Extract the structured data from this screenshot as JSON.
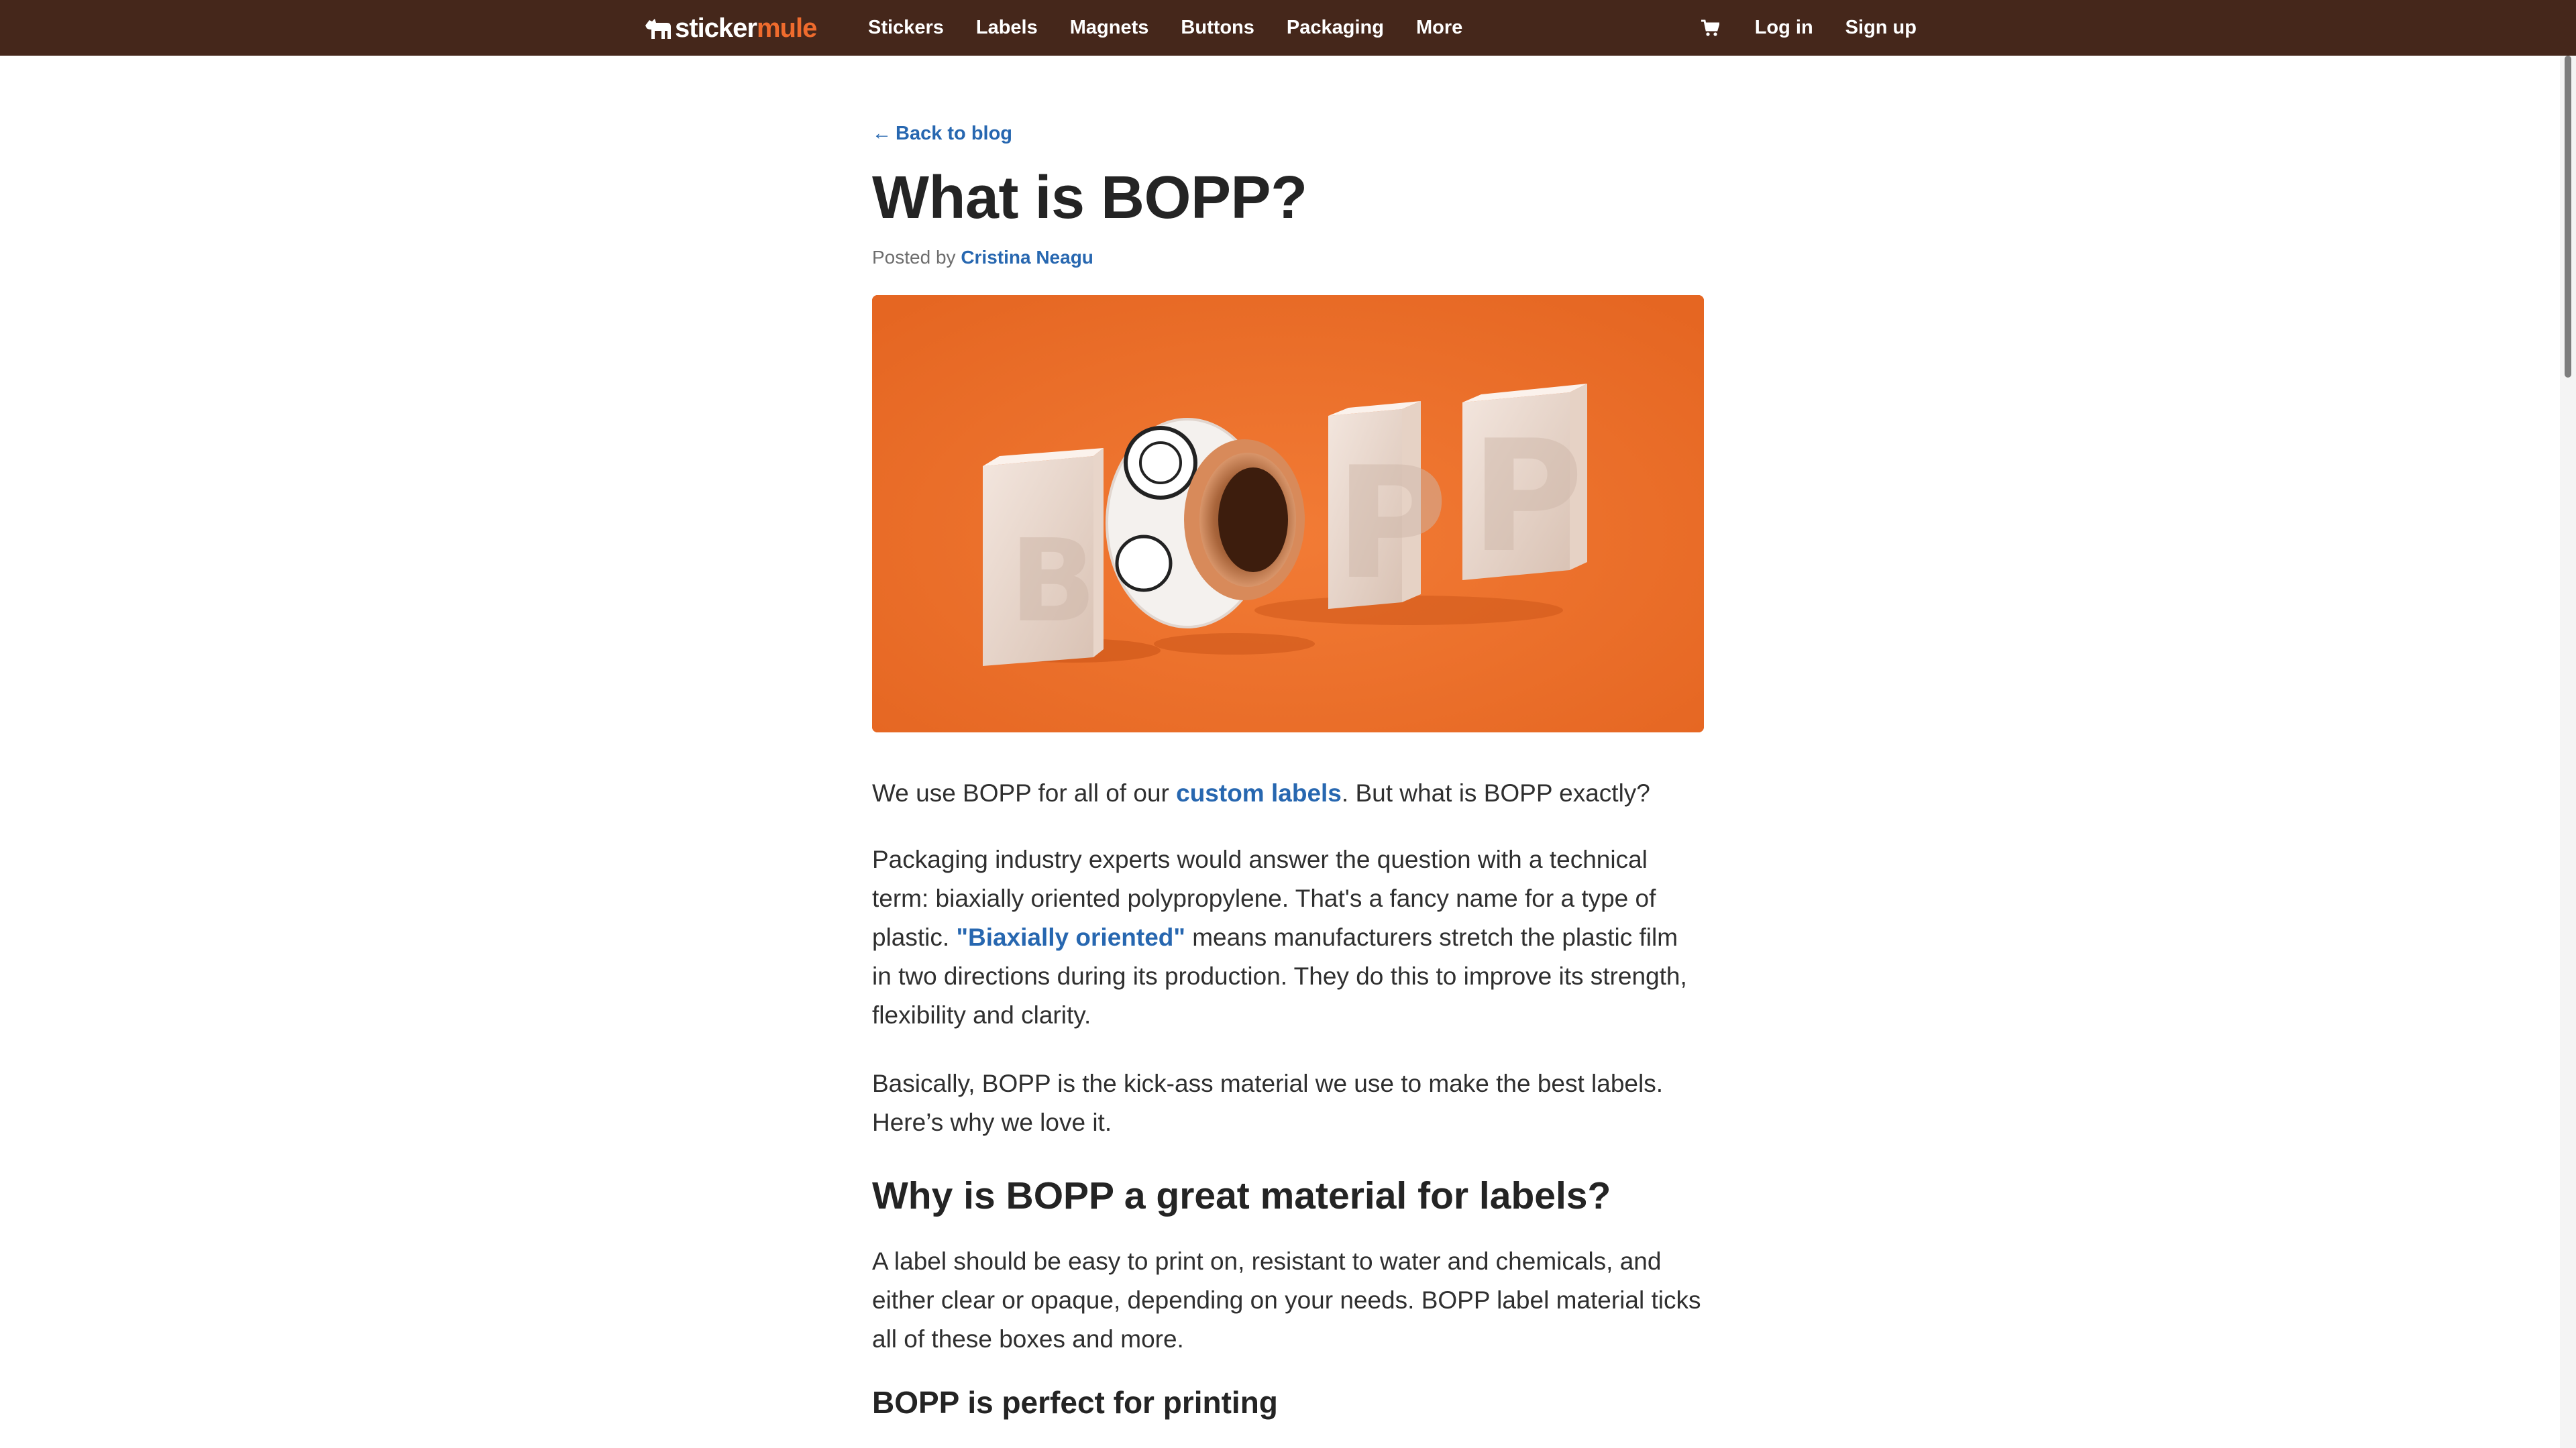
{
  "nav": {
    "brand_part1": "sticker",
    "brand_part2": "mule",
    "links": [
      "Stickers",
      "Labels",
      "Magnets",
      "Buttons",
      "Packaging",
      "More"
    ],
    "cart_icon": "cart-icon",
    "login": "Log in",
    "signup": "Sign up"
  },
  "article": {
    "back_arrow": "←",
    "back_label": "Back to blog",
    "title": "What is BOPP?",
    "posted_by": "Posted by",
    "author": "Cristina Neagu",
    "hero_letters": [
      "B",
      "P",
      "P"
    ],
    "p1": {
      "before": "We use BOPP for all of our ",
      "link": "custom labels",
      "after": ". But what is BOPP exactly?"
    },
    "p2": {
      "before": "Packaging industry experts would answer the question with a technical term: biaxially oriented polypropylene. That's a fancy name for a type of plastic. ",
      "link": "\"Biaxially oriented\"",
      "after": " means manufacturers stretch the plastic film in two directions during its production. They do this to improve its strength, flexibility and clarity."
    },
    "p3": "Basically, BOPP is the kick-ass material we use to make the best labels. Here’s why we love it.",
    "h2": "Why is BOPP a great material for labels?",
    "p4": "A label should be easy to print on, resistant to water and chemicals, and either clear or opaque, depending on your needs. BOPP label material ticks all of these boxes and more.",
    "h3": "BOPP is perfect for printing"
  },
  "colors": {
    "nav_bg": "#45271b",
    "brand_accent": "#ef6b2d",
    "link": "#2767b0",
    "hero_bg": "#ec7430"
  }
}
